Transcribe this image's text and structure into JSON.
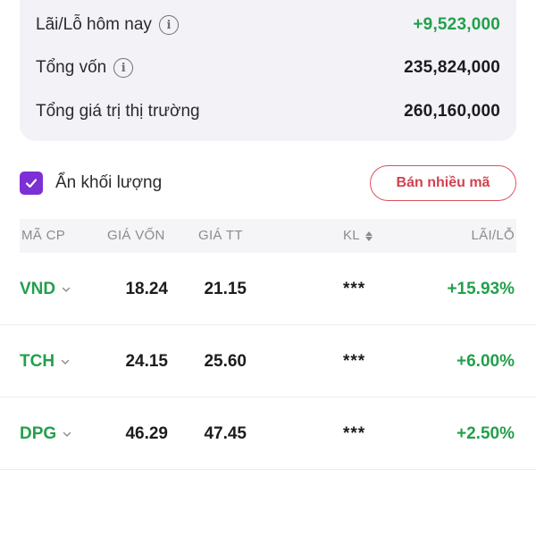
{
  "summary": {
    "today_pl_label": "Lãi/Lỗ hôm nay",
    "today_pl_value": "+9,523,000",
    "capital_label": "Tổng vốn",
    "capital_value": "235,824,000",
    "market_value_label": "Tổng giá trị thị trường",
    "market_value_value": "260,160,000",
    "info_glyph": "i"
  },
  "controls": {
    "hide_volume_label": "Ẩn khối lượng",
    "hide_volume_checked": true,
    "sell_multiple_label": "Bán nhiều mã"
  },
  "table": {
    "headers": {
      "code": "MÃ CP",
      "cost_price": "GIÁ VỐN",
      "market_price": "GIÁ TT",
      "volume": "KL",
      "profit_loss": "LÃI/LỖ"
    },
    "rows": [
      {
        "code": "VND",
        "cost_price": "18.24",
        "market_price": "21.15",
        "volume": "***",
        "profit_loss": "+15.93%"
      },
      {
        "code": "TCH",
        "cost_price": "24.15",
        "market_price": "25.60",
        "volume": "***",
        "profit_loss": "+6.00%"
      },
      {
        "code": "DPG",
        "cost_price": "46.29",
        "market_price": "47.45",
        "volume": "***",
        "profit_loss": "+2.50%"
      }
    ]
  },
  "colors": {
    "positive": "#22a04b",
    "accent_purple": "#7d2fd6",
    "sell_red": "#d2414f",
    "card_bg": "#f3f3f7"
  },
  "icons": [
    "info-icon",
    "check-icon",
    "sort-icon",
    "chevron-down-icon"
  ]
}
